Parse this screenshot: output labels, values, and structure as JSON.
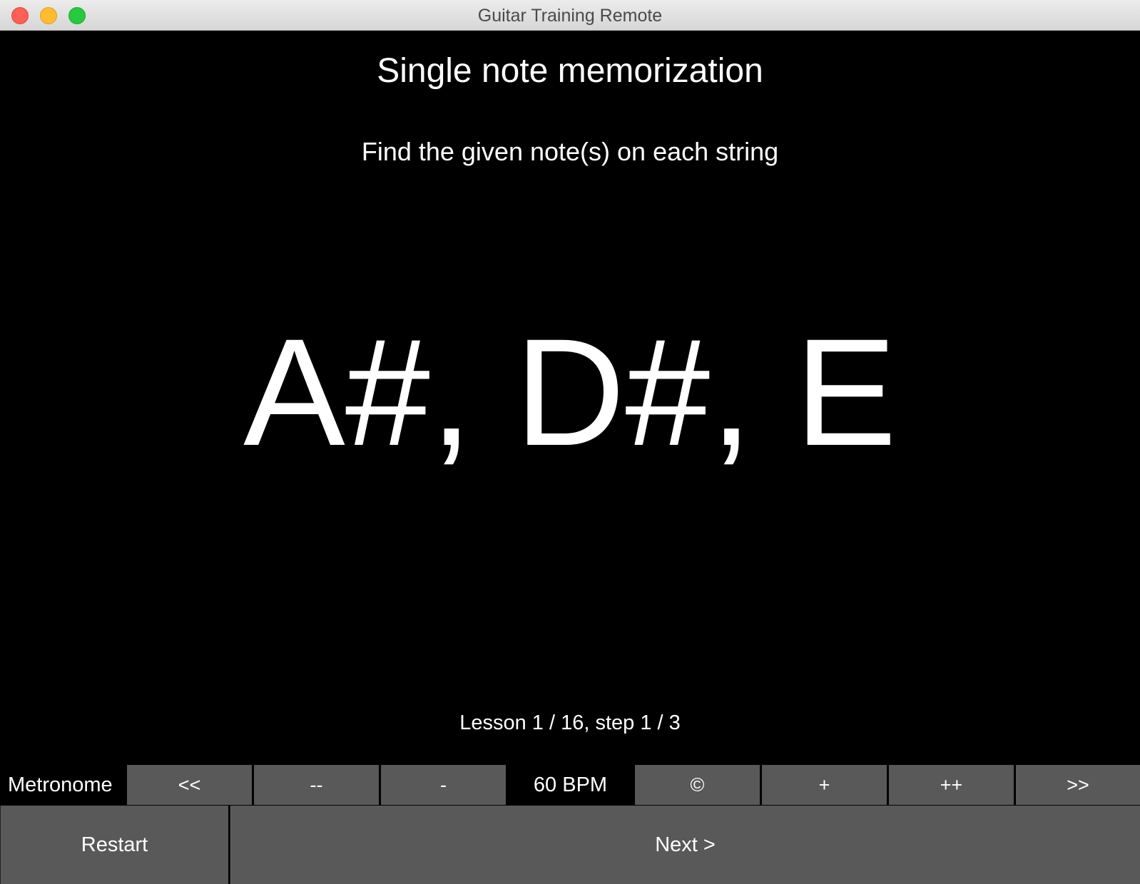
{
  "window": {
    "title": "Guitar Training Remote"
  },
  "lesson": {
    "heading": "Single note memorization",
    "instruction": "Find the given note(s) on each string",
    "notes": "A#, D#, E",
    "progress": "Lesson 1 / 16, step 1 / 3"
  },
  "metronome": {
    "label": "Metronome",
    "buttons": {
      "prev": "<<",
      "decrease_large": "--",
      "decrease": "-",
      "toggle": "©",
      "increase": "+",
      "increase_large": "++",
      "next": ">>"
    },
    "bpm_display": "60 BPM"
  },
  "controls": {
    "restart": "Restart",
    "next": "Next >"
  },
  "colors": {
    "background": "#000000",
    "button": "#595959",
    "text": "#ffffff"
  }
}
